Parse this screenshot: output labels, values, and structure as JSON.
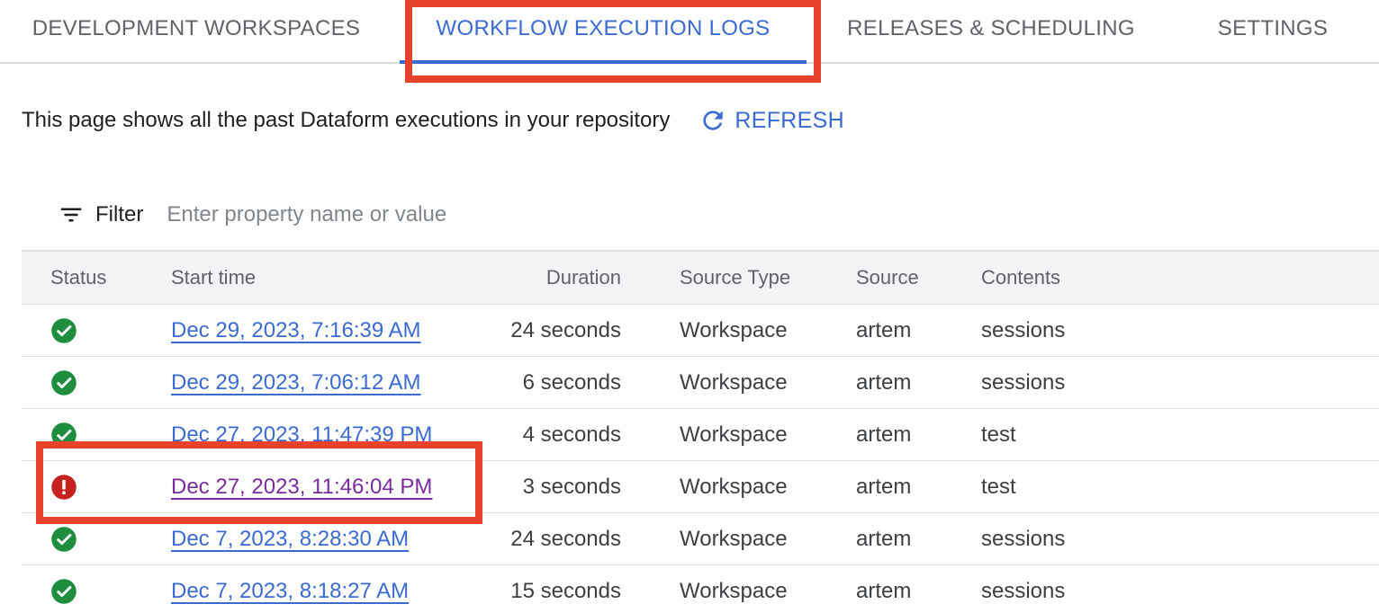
{
  "tabs": [
    {
      "label": "DEVELOPMENT WORKSPACES"
    },
    {
      "label": "WORKFLOW EXECUTION LOGS",
      "active": true
    },
    {
      "label": "RELEASES & SCHEDULING"
    },
    {
      "label": "SETTINGS"
    }
  ],
  "description": "This page shows all the past Dataform executions in your repository",
  "refresh": {
    "label": "REFRESH",
    "icon": "refresh-icon"
  },
  "filter": {
    "label": "Filter",
    "placeholder": "Enter property name or value",
    "icon": "filter-icon"
  },
  "table": {
    "columns": [
      "Status",
      "Start time",
      "Duration",
      "Source Type",
      "Source",
      "Contents"
    ],
    "rows": [
      {
        "status": "success",
        "start_time": "Dec 29, 2023, 7:16:39 AM",
        "duration": "24 seconds",
        "source_type": "Workspace",
        "source": "artem",
        "contents": "sessions"
      },
      {
        "status": "success",
        "start_time": "Dec 29, 2023, 7:06:12 AM",
        "duration": "6 seconds",
        "source_type": "Workspace",
        "source": "artem",
        "contents": "sessions"
      },
      {
        "status": "success",
        "start_time": "Dec 27, 2023, 11:47:39 PM",
        "duration": "4 seconds",
        "source_type": "Workspace",
        "source": "artem",
        "contents": "test"
      },
      {
        "status": "error",
        "start_time": "Dec 27, 2023, 11:46:04 PM",
        "duration": "3 seconds",
        "source_type": "Workspace",
        "source": "artem",
        "contents": "test"
      },
      {
        "status": "success",
        "start_time": "Dec 7, 2023, 8:28:30 AM",
        "duration": "24 seconds",
        "source_type": "Workspace",
        "source": "artem",
        "contents": "sessions"
      },
      {
        "status": "success",
        "start_time": "Dec 7, 2023, 8:18:27 AM",
        "duration": "15 seconds",
        "source_type": "Workspace",
        "source": "artem",
        "contents": "sessions"
      }
    ]
  },
  "colors": {
    "accent": "#3b6ad0",
    "success": "#1e8e3e",
    "error": "#c5221f",
    "visited_link": "#7b2b9c",
    "highlight": "#e8412c"
  }
}
